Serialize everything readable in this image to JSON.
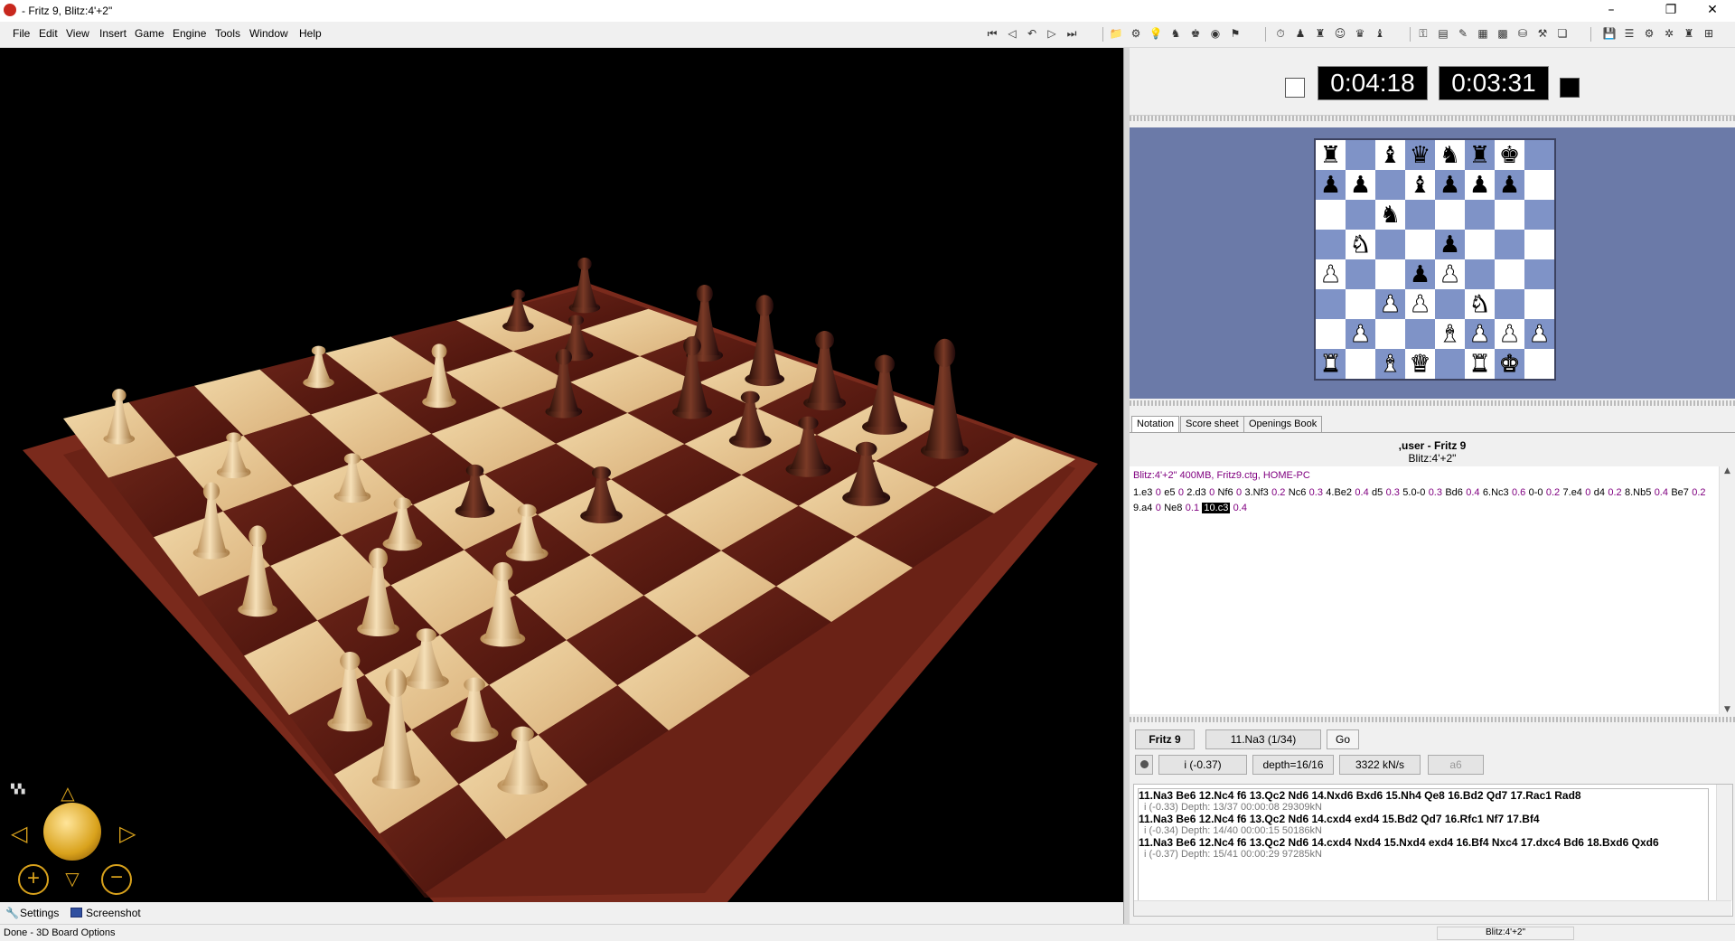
{
  "window": {
    "title": " - Fritz 9, Blitz:4'+2\"",
    "minimize": "–",
    "maximize": "❐",
    "close": "✕"
  },
  "menu": [
    "File",
    "Edit",
    "View",
    "Insert",
    "Game",
    "Engine",
    "Tools",
    "Window",
    "Help"
  ],
  "board3d_controls": {
    "settings_label": "Settings",
    "screenshot_label": "Screenshot"
  },
  "clocks": {
    "white_time": "0:04:18",
    "black_time": "0:03:31"
  },
  "miniboard": {
    "rows": [
      [
        "bR",
        "",
        "bB",
        "bQ",
        "bN",
        "bR",
        "bK",
        ""
      ],
      [
        "bP",
        "bP",
        "",
        "bB",
        "bP",
        "bP",
        "bP",
        ""
      ],
      [
        "",
        "",
        "bN",
        "",
        "",
        "",
        "",
        ""
      ],
      [
        "",
        "wN",
        "",
        "",
        "bP",
        "",
        "",
        ""
      ],
      [
        "wP",
        "",
        "",
        "bP",
        "wP",
        "",
        "",
        ""
      ],
      [
        "",
        "",
        "wP",
        "wP",
        "",
        "wN",
        "",
        ""
      ],
      [
        "",
        "wP",
        "",
        "",
        "wB",
        "wP",
        "wP",
        "wP"
      ],
      [
        "wR",
        "",
        "wB",
        "wQ",
        "",
        "wR",
        "wK",
        ""
      ]
    ]
  },
  "tabs": [
    "Notation",
    "Score sheet",
    "Openings Book"
  ],
  "notation": {
    "heading": ",user - Fritz 9",
    "subheading": "Blitz:4'+2\"",
    "header_line": "Blitz:4'+2\"  400MB, Fritz9.ctg, HOME-PC",
    "moves": [
      {
        "m": "1.e3",
        "e": "0"
      },
      {
        "m": "e5",
        "e": "0"
      },
      {
        "m": "2.d3",
        "e": "0"
      },
      {
        "m": "Nf6",
        "e": "0"
      },
      {
        "m": "3.Nf3",
        "e": "0.2"
      },
      {
        "m": "Nc6",
        "e": "0.3"
      },
      {
        "m": "4.Be2",
        "e": "0.4"
      },
      {
        "m": "d5",
        "e": "0.3"
      },
      {
        "m": "5.0-0",
        "e": "0.3"
      },
      {
        "m": "Bd6",
        "e": "0.4"
      },
      {
        "m": "6.Nc3",
        "e": "0.6"
      },
      {
        "m": "0-0",
        "e": "0.2"
      },
      {
        "m": "7.e4",
        "e": "0"
      },
      {
        "m": "d4",
        "e": "0.2"
      },
      {
        "m": "8.Nb5",
        "e": "0.4"
      },
      {
        "m": "Be7",
        "e": "0.2"
      },
      {
        "m": "9.a4",
        "e": "0"
      },
      {
        "m": "Ne8",
        "e": "0.1"
      },
      {
        "m": "10.c3",
        "e": "0.4",
        "current": true
      }
    ]
  },
  "engine": {
    "name": "Fritz 9",
    "best_move": "11.Na3 (1/34)",
    "go_label": "Go",
    "eval": "i  (-0.37)",
    "depth": "depth=16/16",
    "speed": "3322 kN/s",
    "current_move": "a6",
    "lines": [
      {
        "moves": "11.Na3 Be6 12.Nc4 f6 13.Qc2 Nd6 14.Nxd6 Bxd6 15.Nh4 Qe8 16.Bd2 Qd7 17.Rac1 Rad8",
        "info": "i  (-0.33)   Depth: 13/37   00:00:08  29309kN"
      },
      {
        "moves": "11.Na3 Be6 12.Nc4 f6 13.Qc2 Nd6 14.cxd4 exd4 15.Bd2 Qd7 16.Rfc1 Nf7 17.Bf4",
        "info": "i  (-0.34)   Depth: 14/40   00:00:15  50186kN"
      },
      {
        "moves": "11.Na3 Be6 12.Nc4 f6 13.Qc2 Nd6 14.cxd4 Nxd4 15.Nxd4 exd4 16.Bf4 Nxc4 17.dxc4 Bd6 18.Bxd6 Qxd6",
        "info": "i  (-0.37)   Depth: 15/41   00:00:29  97285kN"
      }
    ]
  },
  "status": {
    "left": "Done - 3D Board Options",
    "right": "Blitz:4'+2\""
  },
  "icons": [
    "app-icon",
    "first-move-icon",
    "prev-move-icon",
    "back-icon",
    "next-move-icon",
    "last-move-icon",
    "new-game-icon",
    "engine-icon",
    "hint-icon",
    "analysis-icon",
    "flag-icon",
    "clock-icon",
    "settings-icon",
    "screenshot-icon"
  ]
}
